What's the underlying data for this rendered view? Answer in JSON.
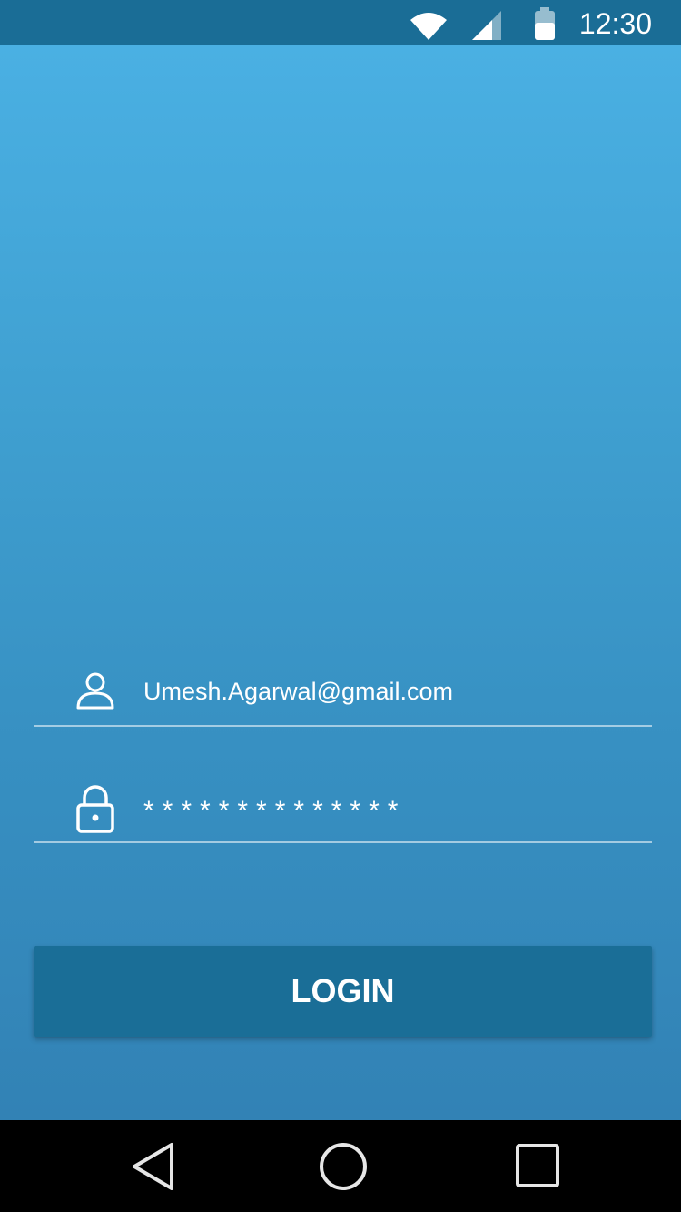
{
  "status_bar": {
    "time": "12:30",
    "icons": [
      "wifi-icon",
      "cellular-signal-icon",
      "battery-icon"
    ]
  },
  "login_form": {
    "email": {
      "icon": "user-icon",
      "value": "Umesh.Agarwal@gmail.com"
    },
    "password": {
      "icon": "lock-icon",
      "value": "**************"
    },
    "login_button_label": "LOGIN"
  },
  "nav_bar": {
    "icons": [
      "back-icon",
      "home-icon",
      "recents-icon"
    ]
  },
  "colors": {
    "status_bar": "#1a6d96",
    "background_top": "#4ab0e3",
    "background_bottom": "#3282b5",
    "button": "#1a6e97",
    "text": "#ffffff",
    "nav_bar": "#000000"
  }
}
